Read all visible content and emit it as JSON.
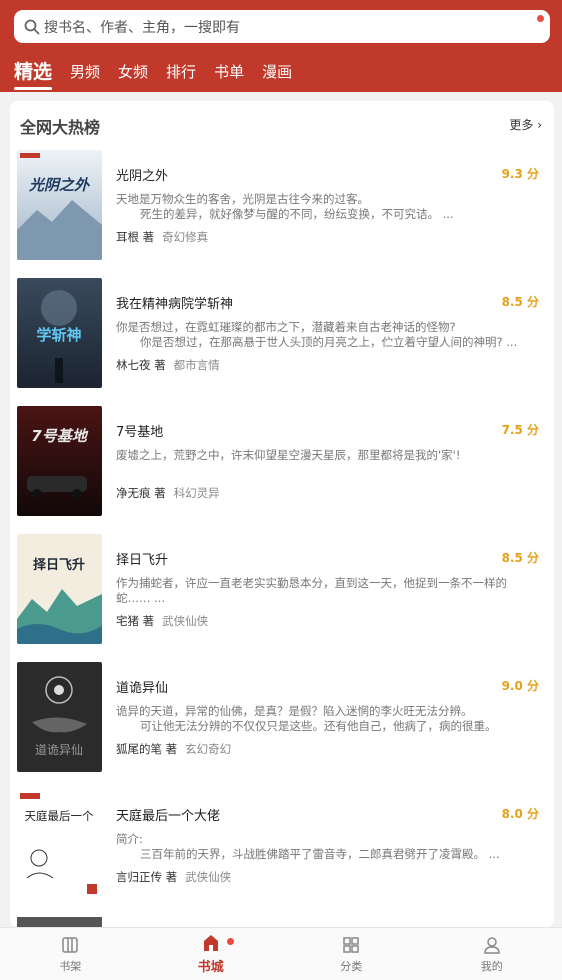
{
  "search": {
    "placeholder": "搜书名、作者、主角，一搜即有"
  },
  "tabs": [
    "精选",
    "男频",
    "女频",
    "排行",
    "书单",
    "漫画"
  ],
  "section": {
    "title": "全网大热榜",
    "more": "更多"
  },
  "books": [
    {
      "title": "光阴之外",
      "score": "9.3 分",
      "desc1": "天地是万物众生的客舍，光阴是古往今来的过客。",
      "desc2": "死生的差异，就好像梦与醒的不同，纷纭变换，不可究诘。 ...",
      "author": "耳根",
      "by": "著",
      "genre": "奇幻修真",
      "cover_text": "光阴之外"
    },
    {
      "title": "我在精神病院学斩神",
      "score": "8.5 分",
      "desc1": "你是否想过，在霓虹璀璨的都市之下，潜藏着来自古老神话的怪物?",
      "desc2": "你是否想过，在那高悬于世人头顶的月亮之上，伫立着守望人间的神明? ...",
      "author": "林七夜",
      "by": "著",
      "genre": "都市言情",
      "cover_text": "学斩神"
    },
    {
      "title": "7号基地",
      "score": "7.5 分",
      "desc1": "废墟之上，荒野之中，许末仰望星空漫天星辰，那里都将是我的'家'!",
      "desc2": "",
      "author": "净无痕",
      "by": "著",
      "genre": "科幻灵异",
      "cover_text": "7号基地"
    },
    {
      "title": "择日飞升",
      "score": "8.5 分",
      "desc1": "作为捕蛇者，许应一直老老实实勤恳本分，直到这一天，他捉到一条不一样的",
      "desc2": "蛇…… ...",
      "author": "宅猪",
      "by": "著",
      "genre": "武侠仙侠",
      "cover_text": "择日飞升"
    },
    {
      "title": "道诡异仙",
      "score": "9.0 分",
      "desc1": "诡异的天道，异常的仙佛，是真？是假？陷入迷惘的李火旺无法分辨。",
      "desc2": "可让他无法分辨的不仅仅只是这些。还有他自己，他病了，病的很重。",
      "author": "狐尾的笔",
      "by": "著",
      "genre": "玄幻奇幻",
      "cover_text": "道诡异仙"
    },
    {
      "title": "天庭最后一个大佬",
      "score": "8.0 分",
      "desc1": "简介:",
      "desc2": "三百年前的天界，斗战胜佛踏平了雷音寺，二郎真君劈开了凌霄殿。 ...",
      "author": "言归正传",
      "by": "著",
      "genre": "武侠仙侠",
      "cover_text": "天庭最后一个"
    }
  ],
  "nav": [
    {
      "label": "书架",
      "icon": "bookshelf-icon"
    },
    {
      "label": "书城",
      "icon": "bookstore-icon"
    },
    {
      "label": "分类",
      "icon": "category-icon"
    },
    {
      "label": "我的",
      "icon": "profile-icon"
    }
  ],
  "colors": {
    "brand": "#c0392b",
    "score": "#e6a019"
  }
}
